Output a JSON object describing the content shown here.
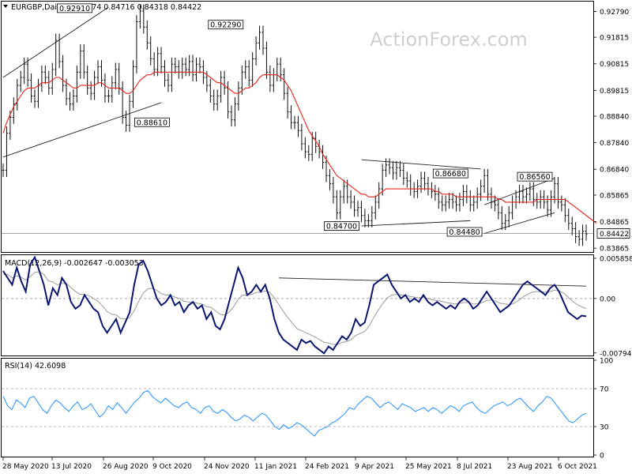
{
  "header": {
    "symbol": "EURGBP,Daily",
    "ohlc": "0.84674 0.84716 0.84318 0.84422",
    "watermark": "ActionForex.com"
  },
  "chart_data": [
    {
      "type": "candlestick",
      "title": "EURGBP,Daily",
      "ylim": [
        0.8375,
        0.931
      ],
      "y_ticks": [
        "0.92790",
        "0.91815",
        "0.90815",
        "0.89815",
        "0.88840",
        "0.87840",
        "0.86840",
        "0.85865",
        "0.84865",
        "0.83865"
      ],
      "last_price": "0.84422",
      "annotations": [
        "0.92910",
        "0.92290",
        "0.88610",
        "0.84700",
        "0.86680",
        "0.86560",
        "0.84480"
      ],
      "series": [
        {
          "name": "price",
          "values": [
            0.868,
            0.882,
            0.888,
            0.893,
            0.9,
            0.903,
            0.908,
            0.902,
            0.896,
            0.894,
            0.9,
            0.905,
            0.903,
            0.899,
            0.906,
            0.917,
            0.909,
            0.9,
            0.895,
            0.893,
            0.896,
            0.905,
            0.913,
            0.905,
            0.899,
            0.897,
            0.903,
            0.907,
            0.902,
            0.896,
            0.896,
            0.901,
            0.906,
            0.899,
            0.888,
            0.885,
            0.894,
            0.907,
            0.924,
            0.928,
            0.922,
            0.916,
            0.91,
            0.906,
            0.912,
            0.907,
            0.902,
            0.9,
            0.908,
            0.907,
            0.905,
            0.908,
            0.906,
            0.909,
            0.904,
            0.908,
            0.907,
            0.903,
            0.9,
            0.896,
            0.893,
            0.896,
            0.903,
            0.899,
            0.89,
            0.887,
            0.893,
            0.899,
            0.905,
            0.907,
            0.902,
            0.91,
            0.916,
            0.92,
            0.914,
            0.905,
            0.9,
            0.904,
            0.908,
            0.904,
            0.897,
            0.89,
            0.886,
            0.886,
            0.883,
            0.878,
            0.875,
            0.874,
            0.88,
            0.877,
            0.875,
            0.871,
            0.866,
            0.863,
            0.858,
            0.852,
            0.858,
            0.862,
            0.858,
            0.856,
            0.853,
            0.854,
            0.851,
            0.849,
            0.849,
            0.852,
            0.856,
            0.861,
            0.868,
            0.87,
            0.869,
            0.867,
            0.869,
            0.868,
            0.865,
            0.864,
            0.861,
            0.86,
            0.862,
            0.865,
            0.863,
            0.861,
            0.86,
            0.859,
            0.856,
            0.855,
            0.856,
            0.857,
            0.856,
            0.855,
            0.857,
            0.86,
            0.858,
            0.855,
            0.856,
            0.859,
            0.862,
            0.866,
            0.859,
            0.856,
            0.855,
            0.852,
            0.848,
            0.849,
            0.852,
            0.856,
            0.858,
            0.86,
            0.858,
            0.859,
            0.861,
            0.857,
            0.856,
            0.858,
            0.856,
            0.853,
            0.858,
            0.863,
            0.856,
            0.855,
            0.851,
            0.848,
            0.846,
            0.843,
            0.842,
            0.845,
            0.844
          ]
        },
        {
          "name": "ma",
          "values": [
            0.882,
            0.886,
            0.889,
            0.892,
            0.894,
            0.896,
            0.898,
            0.899,
            0.899,
            0.899,
            0.9,
            0.901,
            0.901,
            0.901,
            0.902,
            0.903,
            0.903,
            0.902,
            0.901,
            0.9,
            0.899,
            0.899,
            0.9,
            0.9,
            0.9,
            0.9,
            0.9,
            0.901,
            0.901,
            0.9,
            0.899,
            0.899,
            0.899,
            0.899,
            0.898,
            0.897,
            0.897,
            0.898,
            0.9,
            0.902,
            0.903,
            0.904,
            0.904,
            0.905,
            0.905,
            0.905,
            0.905,
            0.905,
            0.905,
            0.905,
            0.905,
            0.905,
            0.905,
            0.905,
            0.905,
            0.905,
            0.905,
            0.905,
            0.904,
            0.903,
            0.902,
            0.901,
            0.901,
            0.9,
            0.899,
            0.898,
            0.897,
            0.897,
            0.898,
            0.899,
            0.899,
            0.9,
            0.901,
            0.903,
            0.904,
            0.904,
            0.904,
            0.904,
            0.904,
            0.903,
            0.902,
            0.9,
            0.898,
            0.895,
            0.892,
            0.889,
            0.886,
            0.883,
            0.881,
            0.879,
            0.877,
            0.874,
            0.872,
            0.87,
            0.868,
            0.866,
            0.865,
            0.864,
            0.863,
            0.862,
            0.861,
            0.86,
            0.859,
            0.859,
            0.858,
            0.858,
            0.858,
            0.859,
            0.86,
            0.861,
            0.861,
            0.861,
            0.861,
            0.861,
            0.861,
            0.861,
            0.861,
            0.861,
            0.861,
            0.861,
            0.861,
            0.861,
            0.861,
            0.86,
            0.86,
            0.859,
            0.859,
            0.859,
            0.859,
            0.858,
            0.858,
            0.858,
            0.858,
            0.858,
            0.858,
            0.858,
            0.858,
            0.858,
            0.858,
            0.858,
            0.858,
            0.857,
            0.857,
            0.856,
            0.856,
            0.856,
            0.856,
            0.856,
            0.856,
            0.856,
            0.856,
            0.856,
            0.857,
            0.857,
            0.857,
            0.857,
            0.857,
            0.857,
            0.857,
            0.857,
            0.857,
            0.856,
            0.855,
            0.854,
            0.853,
            0.852,
            0.851,
            0.85,
            0.849,
            0.848
          ]
        }
      ]
    },
    {
      "type": "line",
      "title": "MACD(12,26,9) -0.002647 -0.003053",
      "ylim": [
        -0.0082,
        0.0062
      ],
      "y_ticks": [
        "0.005858",
        "0.00",
        "-0.007945"
      ],
      "series": [
        {
          "name": "macd",
          "values": [
            0.004,
            0.003,
            0.002,
            0.0045,
            0.0025,
            0.001,
            0.005,
            0.006,
            0.004,
            0.002,
            -0.001,
            0.0015,
            0.0005,
            0.003,
            0.002,
            -0.0005,
            -0.0015,
            -0.001,
            0.0005,
            -0.0005,
            -0.0015,
            -0.002,
            -0.004,
            -0.005,
            -0.004,
            -0.003,
            -0.005,
            -0.0035,
            -0.002,
            0.002,
            0.005,
            0.0055,
            0.004,
            0.002,
            0.0,
            -0.001,
            -0.0005,
            0.0005,
            -0.001,
            -0.0005,
            -0.002,
            -0.001,
            -0.0005,
            -0.0015,
            -0.001,
            -0.003,
            -0.002,
            -0.004,
            -0.0045,
            -0.003,
            -0.0005,
            0.002,
            0.0045,
            0.003,
            0.0005,
            0.001,
            0.002,
            0.001,
            0.002,
            0.0,
            -0.003,
            -0.005,
            -0.006,
            -0.0065,
            -0.007,
            -0.0075,
            -0.006,
            -0.0065,
            -0.0062,
            -0.007,
            -0.0075,
            -0.008,
            -0.007,
            -0.0075,
            -0.0065,
            -0.0055,
            -0.006,
            -0.005,
            -0.003,
            -0.004,
            -0.0035,
            -0.001,
            0.002,
            0.0025,
            0.003,
            0.0035,
            0.002,
            0.001,
            0.0,
            0.0005,
            -0.0005,
            0.0,
            -0.0005,
            0.0005,
            -0.0005,
            -0.001,
            -0.0005,
            -0.001,
            -0.0015,
            -0.001,
            -0.0015,
            -0.0005,
            0.0,
            -0.0005,
            -0.0015,
            -0.001,
            0.0,
            0.001,
            0.0,
            -0.001,
            -0.002,
            -0.0015,
            -0.001,
            0.0,
            0.001,
            0.002,
            0.0025,
            0.002,
            0.0015,
            0.001,
            0.0005,
            0.0015,
            0.002,
            0.001,
            -0.0005,
            -0.002,
            -0.0025,
            -0.003,
            -0.0025,
            -0.0026
          ]
        },
        {
          "name": "signal",
          "values": [
            0.0035,
            0.0035,
            0.003,
            0.0033,
            0.0031,
            0.0027,
            0.0032,
            0.0038,
            0.0039,
            0.0035,
            0.0026,
            0.0024,
            0.002,
            0.0022,
            0.0022,
            0.0016,
            0.001,
            0.0006,
            0.0006,
            0.0004,
            0.0,
            -0.0004,
            -0.0011,
            -0.0019,
            -0.0023,
            -0.0024,
            -0.0029,
            -0.003,
            -0.0028,
            -0.0018,
            -0.0004,
            0.0008,
            0.0014,
            0.0015,
            0.0012,
            0.0007,
            0.0005,
            0.0005,
            0.0002,
            0.0,
            -0.0004,
            -0.0005,
            -0.0005,
            -0.0007,
            -0.0008,
            -0.0012,
            -0.0013,
            -0.0018,
            -0.0023,
            -0.0024,
            -0.002,
            -0.0012,
            -0.0001,
            0.0005,
            0.0005,
            0.0006,
            0.0009,
            0.0009,
            0.0011,
            0.0009,
            0.0001,
            -0.0009,
            -0.0019,
            -0.0028,
            -0.0036,
            -0.0044,
            -0.0047,
            -0.005,
            -0.0053,
            -0.0056,
            -0.006,
            -0.0064,
            -0.0065,
            -0.0067,
            -0.0067,
            -0.0064,
            -0.0063,
            -0.006,
            -0.0054,
            -0.0051,
            -0.0048,
            -0.004,
            -0.0028,
            -0.0017,
            -0.0007,
            0.0001,
            0.0005,
            0.0006,
            0.0005,
            0.0005,
            0.0003,
            0.0002,
            0.0001,
            0.0002,
            0.0,
            -0.0002,
            -0.0003,
            -0.0004,
            -0.0006,
            -0.0007,
            -0.0008,
            -0.0007,
            -0.0006,
            -0.0006,
            -0.0008,
            -0.0008,
            -0.0006,
            -0.0003,
            -0.0002,
            -0.0004,
            -0.0007,
            -0.0008,
            -0.0009,
            -0.0007,
            -0.0003,
            0.0002,
            0.0006,
            0.0009,
            0.001,
            0.001,
            0.0009,
            0.001,
            0.0012,
            0.0011,
            0.0008,
            0.0002,
            -0.0004,
            -0.0009,
            -0.0012,
            -0.0015
          ]
        }
      ]
    },
    {
      "type": "line",
      "title": "RSI(14) 42.6098",
      "ylim": [
        0,
        100
      ],
      "y_ticks": [
        "100",
        "70",
        "30",
        "0"
      ],
      "series": [
        {
          "name": "rsi",
          "values": [
            62,
            52,
            48,
            58,
            55,
            50,
            60,
            62,
            55,
            48,
            44,
            52,
            58,
            55,
            50,
            46,
            52,
            56,
            48,
            50,
            54,
            47,
            40,
            44,
            52,
            48,
            55,
            50,
            44,
            50,
            56,
            60,
            66,
            68,
            62,
            58,
            55,
            60,
            56,
            52,
            50,
            54,
            56,
            50,
            48,
            44,
            50,
            52,
            46,
            44,
            48,
            45,
            40,
            36,
            38,
            42,
            40,
            36,
            40,
            44,
            42,
            36,
            30,
            27,
            32,
            28,
            30,
            34,
            32,
            28,
            24,
            20,
            26,
            28,
            30,
            34,
            36,
            40,
            44,
            50,
            48,
            54,
            58,
            62,
            60,
            55,
            50,
            54,
            56,
            52,
            48,
            54,
            52,
            50,
            46,
            48,
            50,
            46,
            50,
            48,
            44,
            48,
            52,
            50,
            46,
            52,
            54,
            56,
            50,
            46,
            44,
            48,
            52,
            54,
            56,
            52,
            54,
            58,
            60,
            55,
            50,
            46,
            52,
            56,
            62,
            60,
            54,
            48,
            42,
            36,
            34,
            38,
            42,
            44
          ]
        }
      ]
    }
  ],
  "x_labels": [
    "28 May 2020",
    "13 Jul 2020",
    "26 Aug 2020",
    "9 Oct 2020",
    "24 Nov 2020",
    "11 Jan 2021",
    "24 Feb 2021",
    "9 Apr 2021",
    "25 May 2021",
    "8 Jul 2021",
    "23 Aug 2021",
    "6 Oct 2021"
  ]
}
